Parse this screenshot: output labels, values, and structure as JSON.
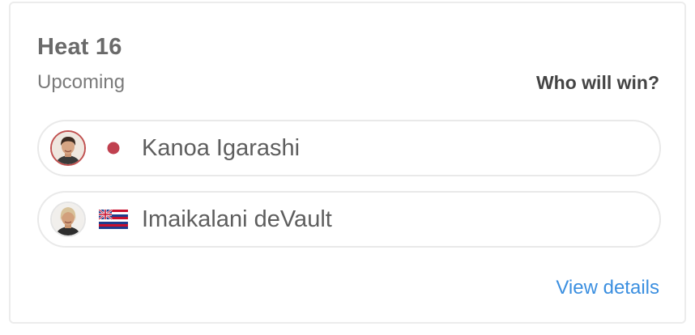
{
  "heat": {
    "title": "Heat 16",
    "status": "Upcoming",
    "prompt": "Who will win?",
    "link_label": "View details"
  },
  "surfers": [
    {
      "name": "Kanoa Igarashi",
      "flag_icon": "japan-flag-icon",
      "avatar_ring_color": "#c0504f"
    },
    {
      "name": "Imaikalani deVault",
      "flag_icon": "hawaii-flag-icon",
      "avatar_ring_color": "#e4e4e4"
    }
  ],
  "colors": {
    "link": "#3b8fe0",
    "japan_dot": "#c0404f"
  }
}
